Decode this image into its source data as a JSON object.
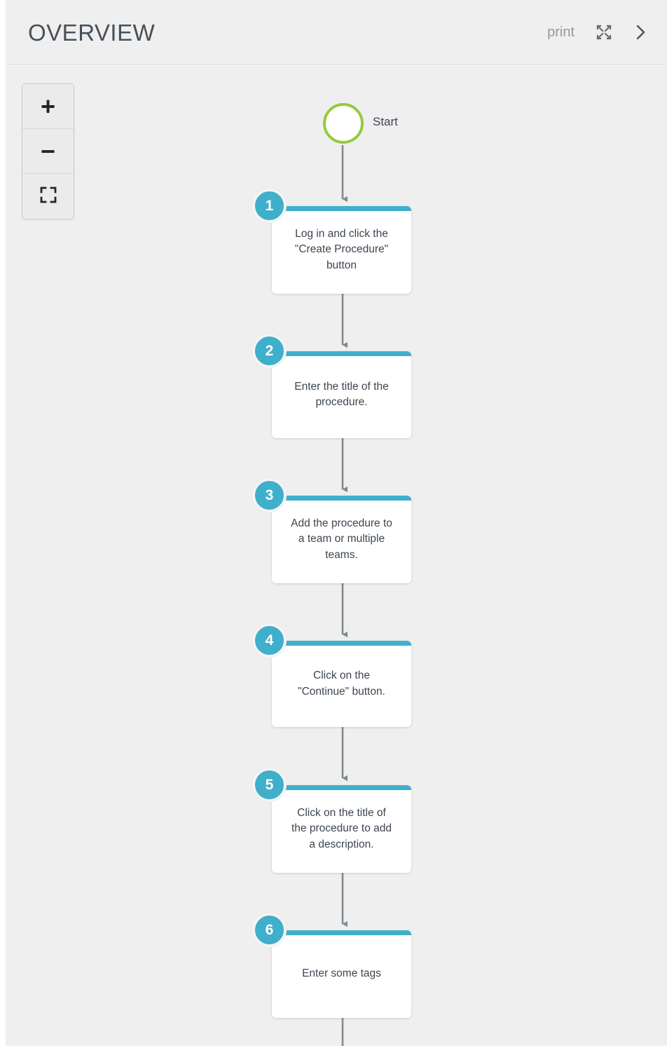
{
  "header": {
    "title": "OVERVIEW",
    "print_label": "print",
    "fullscreen_icon": "expand-arrows-icon",
    "next_icon": "chevron-right-icon"
  },
  "zoom_controls": {
    "zoom_in_label": "+",
    "zoom_out_label": "−",
    "fit_icon": "fit-to-screen-icon"
  },
  "colors": {
    "accent": "#3fafcb",
    "start_ring": "#97c93d",
    "canvas_bg": "#efefef",
    "connector": "#7f8a92",
    "text": "#3c4650"
  },
  "diagram": {
    "start": {
      "label": "Start",
      "shape": "circle"
    },
    "steps": [
      {
        "number": "1",
        "text": "Log in and click the\n\"Create Procedure\"\nbutton"
      },
      {
        "number": "2",
        "text": "Enter the title of the\nprocedure."
      },
      {
        "number": "3",
        "text": "Add the procedure to\na team or multiple\nteams."
      },
      {
        "number": "4",
        "text": "Click on the\n\"Continue\" button."
      },
      {
        "number": "5",
        "text": "Click on the title of\nthe procedure to add\na description."
      },
      {
        "number": "6",
        "text": "Enter some tags"
      }
    ]
  }
}
